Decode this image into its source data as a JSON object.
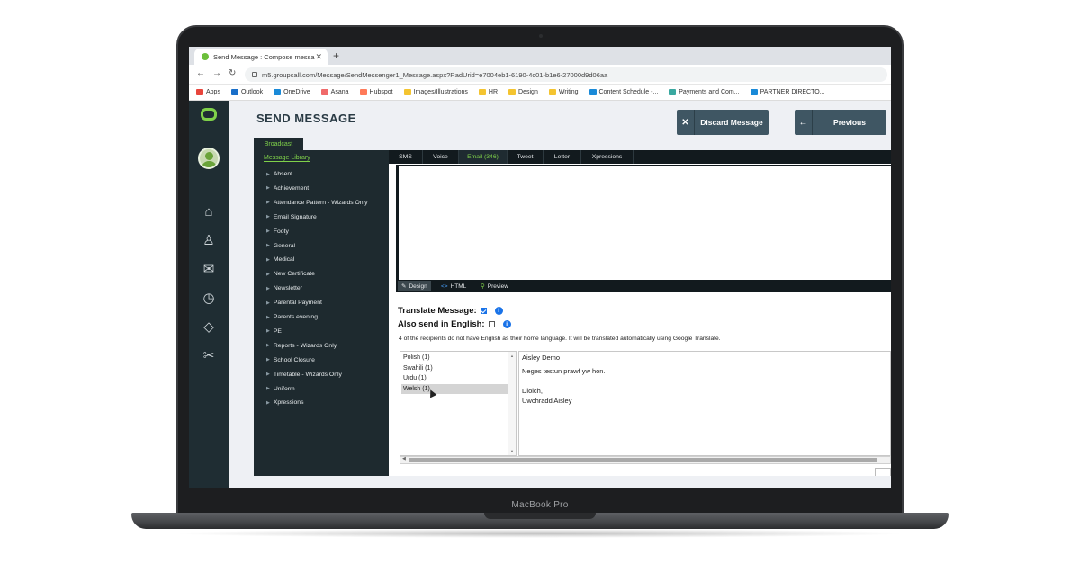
{
  "device": {
    "label": "MacBook Pro"
  },
  "browser": {
    "tab_title": "Send Message : Compose messa",
    "url": "m5.groupcall.com/Message/SendMessenger1_Message.aspx?RadUrid=e7004eb1-6190-4c01-b1e6-27000d9d06aa",
    "bookmarks": [
      {
        "label": "Apps",
        "color": "#e8453c"
      },
      {
        "label": "Outlook",
        "color": "#1a6fc9"
      },
      {
        "label": "OneDrive",
        "color": "#1a8ad8"
      },
      {
        "label": "Asana",
        "color": "#f06a6a"
      },
      {
        "label": "Hubspot",
        "color": "#ff7a59"
      },
      {
        "label": "Images/Illustrations",
        "color": "#f4c430"
      },
      {
        "label": "HR",
        "color": "#f4c430"
      },
      {
        "label": "Design",
        "color": "#f4c430"
      },
      {
        "label": "Writing",
        "color": "#f4c430"
      },
      {
        "label": "Content Schedule -...",
        "color": "#1a8ad8"
      },
      {
        "label": "Payments and Com...",
        "color": "#3aa8a0"
      },
      {
        "label": "PARTNER DIRECTO...",
        "color": "#1a8ad8"
      }
    ]
  },
  "app": {
    "title": "SEND MESSAGE",
    "discard_label": "Discard Message",
    "previous_label": "Previous",
    "broadcast_label": "Broadcast",
    "library_heading": "Message Library",
    "library_items": [
      "Absent",
      "Achievement",
      "Attendance Pattern - Wizards Only",
      "Email Signature",
      "Footy",
      "General",
      "Medical",
      "New Certificate",
      "Newsletter",
      "Parental Payment",
      "Parents evening",
      "PE",
      "Reports - Wizards Only",
      "School Closure",
      "Timetable - Wizards Only",
      "Uniform",
      "Xpressions"
    ],
    "channel_tabs": [
      "SMS",
      "Voice",
      "Email (346)",
      "Tweet",
      "Letter",
      "Xpressions"
    ],
    "active_channel": "Email (346)",
    "editor_modes": [
      "Design",
      "HTML",
      "Preview"
    ],
    "translate_label": "Translate Message:",
    "translate_checked": true,
    "english_label": "Also send in English:",
    "english_checked": false,
    "translate_note": "4 of the recipients do not have English as their home language. It will be translated automatically using Google Translate.",
    "languages": [
      "Polish (1)",
      "Swahili (1)",
      "Urdu (1)",
      "Welsh (1)"
    ],
    "selected_language": "Welsh (1)",
    "preview": {
      "name": "Aisley Demo",
      "body": "Neges testun prawf yw hon.",
      "closing": "Diolch,",
      "signature": "Uwchradd Aisley"
    }
  },
  "colors": {
    "accent_green": "#7fd14a",
    "rail": "#1f2d33",
    "button": "#3f5663",
    "info_blue": "#1a73e8"
  }
}
